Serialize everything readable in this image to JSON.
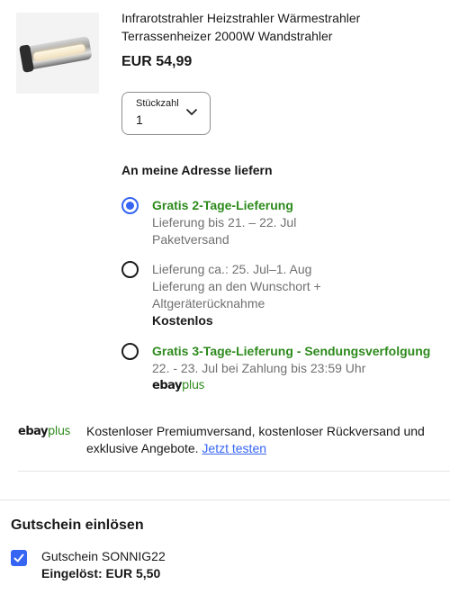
{
  "product": {
    "title": "Infrarotstrahler Heizstrahler Wärmestrahler Terrassenheizer 2000W Wandstrahler",
    "price": "EUR 54,99"
  },
  "quantity": {
    "label": "Stückzahl",
    "value": "1"
  },
  "delivery": {
    "heading": "An meine Adresse liefern",
    "options": [
      {
        "selected": true,
        "title": "Gratis 2-Tage-Lieferung",
        "line2": "Lieferung bis 21. – 22. Jul",
        "line3": "Paketversand"
      },
      {
        "selected": false,
        "line1": "Lieferung ca.: 25. Jul–1. Aug",
        "line2": "Lieferung an den Wunschort +",
        "line3": "Altgeräterücknahme",
        "line4": "Kostenlos"
      },
      {
        "selected": false,
        "title": "Gratis 3-Tage-Lieferung - Sendungsverfolgung",
        "line2": "22. - 23. Jul bei Zahlung bis 23:59 Uhr",
        "badge_ebay": "ebay",
        "badge_plus": "plus"
      }
    ]
  },
  "plus_banner": {
    "logo_ebay": "ebay",
    "logo_plus": "plus",
    "text": "Kostenloser Premiumversand, kostenloser Rückversand und exklusive Angebote.",
    "link": "Jetzt testen"
  },
  "voucher": {
    "heading": "Gutschein einlösen",
    "checked": true,
    "name": "Gutschein SONNIG22",
    "applied": "Eingelöst: EUR 5,50"
  },
  "colors": {
    "accent_blue": "#3665f3",
    "plus_green": "#2d8a1c",
    "text": "#191919",
    "secondary_text": "#707070"
  }
}
